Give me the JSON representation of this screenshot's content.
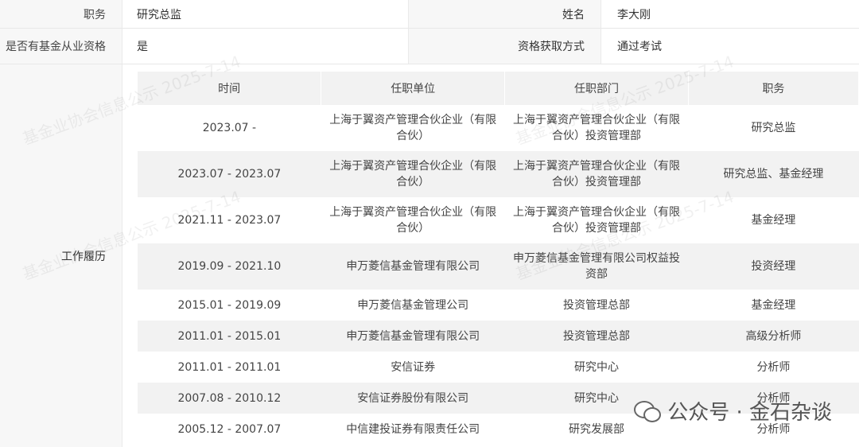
{
  "info": {
    "row1": {
      "label_left": "职务",
      "value_left": "研究总监",
      "label_right": "姓名",
      "value_right": "李大刚"
    },
    "row2": {
      "label_left": "是否有基金从业资格",
      "value_left": "是",
      "label_right": "资格获取方式",
      "value_right": "通过考试"
    }
  },
  "work": {
    "label": "工作履历",
    "headers": [
      "时间",
      "任职单位",
      "任职部门",
      "职务"
    ],
    "rows": [
      [
        "2023.07 -",
        "上海于翼资产管理合伙企业（有限合伙）",
        "上海于翼资产管理合伙企业（有限合伙）投资管理部",
        "研究总监"
      ],
      [
        "2023.07 - 2023.07",
        "上海于翼资产管理合伙企业（有限合伙）",
        "上海于翼资产管理合伙企业（有限合伙）投资管理部",
        "研究总监、基金经理"
      ],
      [
        "2021.11 - 2023.07",
        "上海于翼资产管理合伙企业（有限合伙）",
        "上海于翼资产管理合伙企业（有限合伙）投资管理部",
        "基金经理"
      ],
      [
        "2019.09 - 2021.10",
        "申万菱信基金管理有限公司",
        "申万菱信基金管理有限公司权益投资部",
        "投资经理"
      ],
      [
        "2015.01 - 2019.09",
        "申万菱信基金管理公司",
        "投资管理总部",
        "基金经理"
      ],
      [
        "2011.01 - 2015.01",
        "申万菱信基金管理有限公司",
        "投资管理总部",
        "高级分析师"
      ],
      [
        "2011.01 - 2011.01",
        "安信证券",
        "研究中心",
        "分析师"
      ],
      [
        "2007.08 - 2010.12",
        "安信证券股份有限公司",
        "研究中心",
        "分析师"
      ],
      [
        "2005.12 - 2007.07",
        "中信建投证券有限责任公司",
        "研究发展部",
        "分析师"
      ]
    ]
  },
  "watermark_text": "基金业协会信息公示 2025-7-14",
  "brand": {
    "text": "公众号 · 金石杂谈",
    "icon": "wechat-icon"
  }
}
